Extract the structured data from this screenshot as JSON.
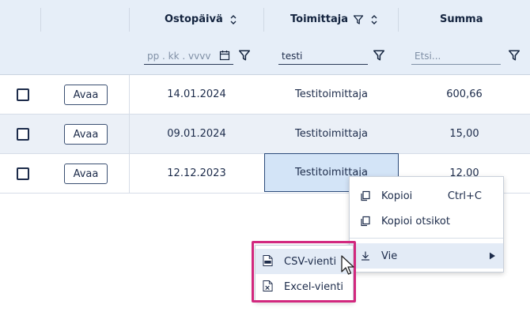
{
  "header": {
    "columns": [
      {
        "label": "Ostopäivä"
      },
      {
        "label": "Toimittaja"
      },
      {
        "label": "Summa"
      }
    ],
    "filters": {
      "date_placeholder": "pp . kk . vvvv",
      "supplier_value": "testi",
      "amount_placeholder": "Etsi..."
    }
  },
  "rows": [
    {
      "open_label": "Avaa",
      "date": "14.01.2024",
      "supplier": "Testitoimittaja",
      "amount": "600,66"
    },
    {
      "open_label": "Avaa",
      "date": "09.01.2024",
      "supplier": "Testitoimittaja",
      "amount": "15,00"
    },
    {
      "open_label": "Avaa",
      "date": "12.12.2023",
      "supplier": "Testitoimittaja",
      "amount": "12,00"
    }
  ],
  "context_menu": {
    "copy_label": "Kopioi",
    "copy_shortcut": "Ctrl+C",
    "copy_headers_label": "Kopioi otsikot",
    "export_label": "Vie"
  },
  "export_submenu": {
    "csv_label": "CSV-vienti",
    "excel_label": "Excel-vienti"
  },
  "colors": {
    "header_bg": "#e6eef8",
    "alt_row_bg": "#ebf0f7",
    "selected_cell_bg": "#d3e4f7",
    "highlight_border": "#d2287e",
    "text": "#1c2b4a"
  }
}
